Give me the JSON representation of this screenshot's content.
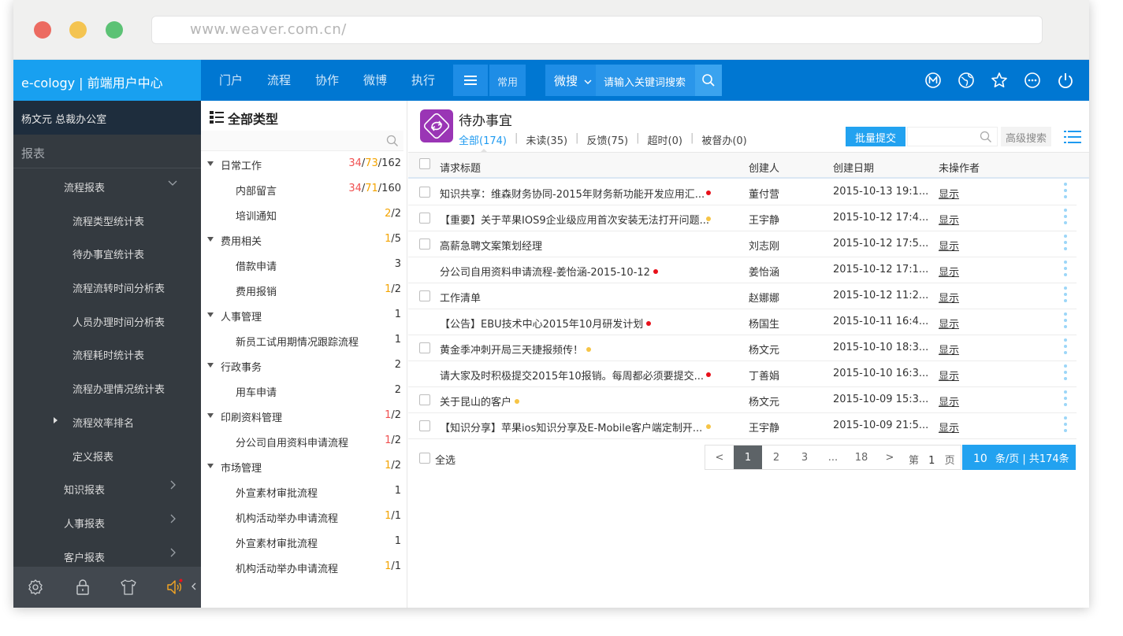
{
  "browser": {
    "url": "www.weaver.com.cn/"
  },
  "topbar": {
    "brand": "e-cology | 前端用户中心",
    "nav": [
      "门户",
      "流程",
      "协作",
      "微博",
      "执行"
    ],
    "common_label": "常用",
    "search_type": "微搜",
    "search_placeholder": "请输入关键词搜索",
    "icons": [
      "m-icon",
      "globe-icon",
      "star-icon",
      "more-icon",
      "power-icon"
    ]
  },
  "sidebar": {
    "user": "杨文元 总裁办公室",
    "section": "报表",
    "items": [
      {
        "label": "流程报表",
        "level": 1,
        "marker": "chevron-down"
      },
      {
        "label": "流程类型统计表",
        "level": 2
      },
      {
        "label": "待办事宜统计表",
        "level": 2
      },
      {
        "label": "流程流转时间分析表",
        "level": 2
      },
      {
        "label": "人员办理时间分析表",
        "level": 2
      },
      {
        "label": "流程耗时统计表",
        "level": 2
      },
      {
        "label": "流程办理情况统计表",
        "level": 2
      },
      {
        "label": "流程效率排名",
        "level": 2,
        "marker": "triangle"
      },
      {
        "label": "定义报表",
        "level": 2
      },
      {
        "label": "知识报表",
        "level": 1,
        "marker": "chevron-right"
      },
      {
        "label": "人事报表",
        "level": 1,
        "marker": "chevron-right"
      },
      {
        "label": "客户报表",
        "level": 1,
        "marker": "chevron-right"
      }
    ],
    "bottom_icons": [
      "settings-icon",
      "lock-icon",
      "shirt-icon",
      "speaker-icon"
    ]
  },
  "tree": {
    "title": "全部类型",
    "rows": [
      {
        "label": "日常工作",
        "parent": true,
        "counts": [
          {
            "v": "34",
            "c": "red"
          },
          {
            "v": "/",
            "c": "dark"
          },
          {
            "v": "73",
            "c": "orange"
          },
          {
            "v": "/162",
            "c": "dark"
          }
        ]
      },
      {
        "label": "内部留言",
        "parent": false,
        "counts": [
          {
            "v": "34",
            "c": "red"
          },
          {
            "v": "/",
            "c": "dark"
          },
          {
            "v": "71",
            "c": "orange"
          },
          {
            "v": "/160",
            "c": "dark"
          }
        ]
      },
      {
        "label": "培训通知",
        "parent": false,
        "counts": [
          {
            "v": "2",
            "c": "orange"
          },
          {
            "v": "/2",
            "c": "dark"
          }
        ]
      },
      {
        "label": "费用相关",
        "parent": true,
        "counts": [
          {
            "v": "1",
            "c": "orange"
          },
          {
            "v": "/5",
            "c": "dark"
          }
        ]
      },
      {
        "label": "借款申请",
        "parent": false,
        "counts": [
          {
            "v": "3",
            "c": "dark"
          }
        ]
      },
      {
        "label": "费用报销",
        "parent": false,
        "counts": [
          {
            "v": "1",
            "c": "orange"
          },
          {
            "v": "/2",
            "c": "dark"
          }
        ]
      },
      {
        "label": "人事管理",
        "parent": true,
        "counts": [
          {
            "v": "1",
            "c": "dark"
          }
        ]
      },
      {
        "label": "新员工试用期情况跟踪流程",
        "parent": false,
        "counts": [
          {
            "v": "1",
            "c": "dark"
          }
        ]
      },
      {
        "label": "行政事务",
        "parent": true,
        "counts": [
          {
            "v": "2",
            "c": "dark"
          }
        ]
      },
      {
        "label": "用车申请",
        "parent": false,
        "counts": [
          {
            "v": "2",
            "c": "dark"
          }
        ]
      },
      {
        "label": "印刷资料管理",
        "parent": true,
        "counts": [
          {
            "v": "1",
            "c": "red"
          },
          {
            "v": "/2",
            "c": "dark"
          }
        ]
      },
      {
        "label": "分公司自用资料申请流程",
        "parent": false,
        "counts": [
          {
            "v": "1",
            "c": "red"
          },
          {
            "v": "/2",
            "c": "dark"
          }
        ]
      },
      {
        "label": "市场管理",
        "parent": true,
        "counts": [
          {
            "v": "1",
            "c": "orange"
          },
          {
            "v": "/2",
            "c": "dark"
          }
        ]
      },
      {
        "label": "外宣素材审批流程",
        "parent": false,
        "counts": [
          {
            "v": "1",
            "c": "dark"
          }
        ]
      },
      {
        "label": "机构活动举办申请流程",
        "parent": false,
        "counts": [
          {
            "v": "1",
            "c": "orange"
          },
          {
            "v": "/1",
            "c": "dark"
          }
        ]
      },
      {
        "label": "外宣素材审批流程",
        "parent": false,
        "counts": [
          {
            "v": "1",
            "c": "dark"
          }
        ]
      },
      {
        "label": "机构活动举办申请流程",
        "parent": false,
        "counts": [
          {
            "v": "1",
            "c": "orange"
          },
          {
            "v": "/1",
            "c": "dark"
          }
        ]
      }
    ]
  },
  "main": {
    "title": "待办事宜",
    "filters": [
      "全部(174)",
      "未读(35)",
      "反馈(75)",
      "超时(0)",
      "被督办(0)"
    ],
    "active_filter": 0,
    "batch_submit": "批量提交",
    "advanced_search": "高级搜索",
    "columns": [
      "请求标题",
      "创建人",
      "创建日期",
      "未操作者"
    ],
    "rows": [
      {
        "title": "知识共享：维森财务协同-2015年财务新功能开发应用汇...",
        "flag": "red",
        "flag_pos": "end",
        "checkbox": true,
        "creator": "董付营",
        "date": "2015-10-13 19:1...",
        "pending": "显示"
      },
      {
        "title": "【重要】关于苹果IOS9企业级应用首次安装无法打开问题...",
        "flag": "orange",
        "flag_pos": "end",
        "checkbox": true,
        "creator": "王宇静",
        "date": "2015-10-12 17:4...",
        "pending": "显示"
      },
      {
        "title": "高薪急聘文案策划经理",
        "flag": "",
        "flag_pos": "",
        "checkbox": true,
        "creator": "刘志刚",
        "date": "2015-10-12 17:5...",
        "pending": "显示"
      },
      {
        "title": "分公司自用资料申请流程-姜怡涵-2015-10-12",
        "flag": "red",
        "flag_pos": "inline",
        "checkbox": false,
        "creator": "姜怡涵",
        "date": "2015-10-12 17:1...",
        "pending": "显示"
      },
      {
        "title": "工作清单",
        "flag": "",
        "flag_pos": "",
        "checkbox": true,
        "creator": "赵娜娜",
        "date": "2015-10-12 11:2...",
        "pending": "显示"
      },
      {
        "title": "【公告】EBU技术中心2015年10月研发计划",
        "flag": "red",
        "flag_pos": "inline",
        "checkbox": false,
        "creator": "杨国生",
        "date": "2015-10-11 16:4...",
        "pending": "显示"
      },
      {
        "title": "黄金季冲刺开局三天捷报频传！",
        "flag": "orange",
        "flag_pos": "inline",
        "checkbox": true,
        "creator": "杨文元",
        "date": "2015-10-10 18:3...",
        "pending": "显示"
      },
      {
        "title": "请大家及时积极提交2015年10报销。每周都必须要提交...",
        "flag": "red",
        "flag_pos": "end",
        "checkbox": false,
        "creator": "丁善娟",
        "date": "2015-10-10 16:3...",
        "pending": "显示"
      },
      {
        "title": "关于昆山的客户",
        "flag": "orange",
        "flag_pos": "inline",
        "checkbox": true,
        "creator": "杨文元",
        "date": "2015-10-09 15:3...",
        "pending": "显示"
      },
      {
        "title": "【知识分享】苹果ios知识分享及E-Mobile客户端定制开...",
        "flag": "orange",
        "flag_pos": "end",
        "checkbox": true,
        "creator": "王宇静",
        "date": "2015-10-09 21:5...",
        "pending": "显示"
      }
    ],
    "select_all": "全选",
    "pager": {
      "prev": "<",
      "pages": [
        "1",
        "2",
        "3",
        "...",
        "18"
      ],
      "current": "1",
      "next": ">",
      "goto_prefix": "第",
      "goto_value": "1",
      "goto_suffix": "页",
      "per_page": "10",
      "per_page_text": "条/页 | 共174条"
    }
  },
  "colors": {
    "topbar": "#0077d2",
    "brand": "#18a0f0",
    "sidebar": "#343a40",
    "accent": "#22a2f0",
    "red": "#e8101a",
    "orange": "#f4a400"
  }
}
